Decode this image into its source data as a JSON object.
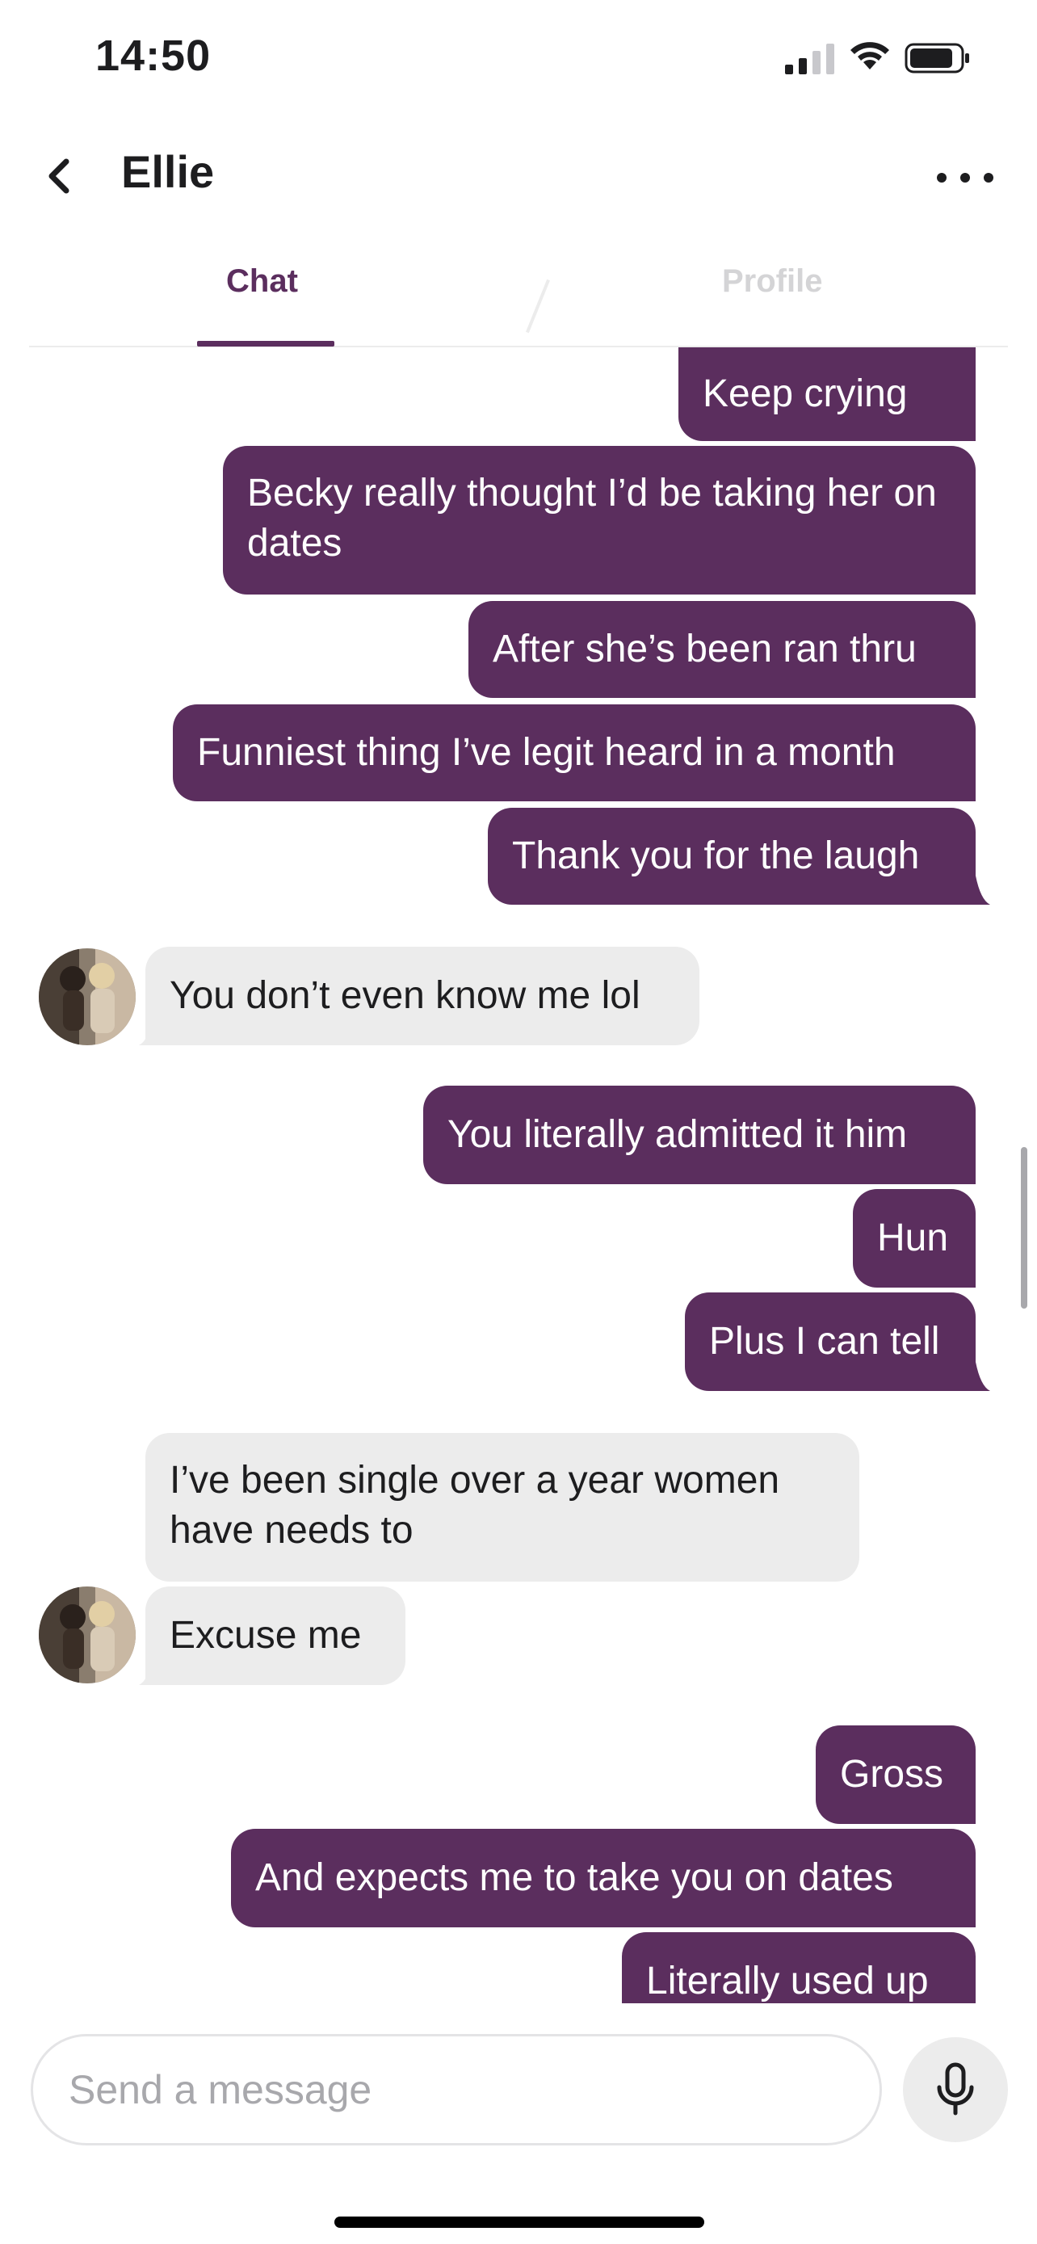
{
  "status_bar": {
    "time": "14:50",
    "icons": [
      "signal-icon",
      "wifi-icon",
      "battery-icon"
    ]
  },
  "header": {
    "title": "Ellie",
    "back_icon": "chevron-left-icon",
    "more_icon": "more-horizontal-icon"
  },
  "tabs": [
    {
      "label": "Chat",
      "active": true
    },
    {
      "label": "Profile",
      "active": false
    }
  ],
  "messages": [
    {
      "sender": "me",
      "text": "Keep  crying"
    },
    {
      "sender": "me",
      "text": "Becky really thought I’d be taking her on dates"
    },
    {
      "sender": "me",
      "text": "After she’s been ran thru"
    },
    {
      "sender": "me",
      "text": "Funniest thing I’ve legit heard in a month"
    },
    {
      "sender": "me",
      "text": "Thank you for the laugh"
    },
    {
      "sender": "them",
      "text": "You don’t even know me lol"
    },
    {
      "sender": "me",
      "text": "You literally admitted it him"
    },
    {
      "sender": "me",
      "text": "Hun"
    },
    {
      "sender": "me",
      "text": "Plus I can tell"
    },
    {
      "sender": "them",
      "text": "I’ve been single over a year women have needs to"
    },
    {
      "sender": "them",
      "text": "Excuse me"
    },
    {
      "sender": "me",
      "text": "Gross"
    },
    {
      "sender": "me",
      "text": "And expects me to take you on dates"
    },
    {
      "sender": "me",
      "text": "Literally used up"
    }
  ],
  "composer": {
    "placeholder": "Send a message",
    "mic_icon": "microphone-icon"
  },
  "colors": {
    "outgoing_bubble": "#5b2e5e",
    "incoming_bubble": "#ececec",
    "active_tab": "#5b2e5e",
    "inactive_tab": "#d4d4d6"
  }
}
